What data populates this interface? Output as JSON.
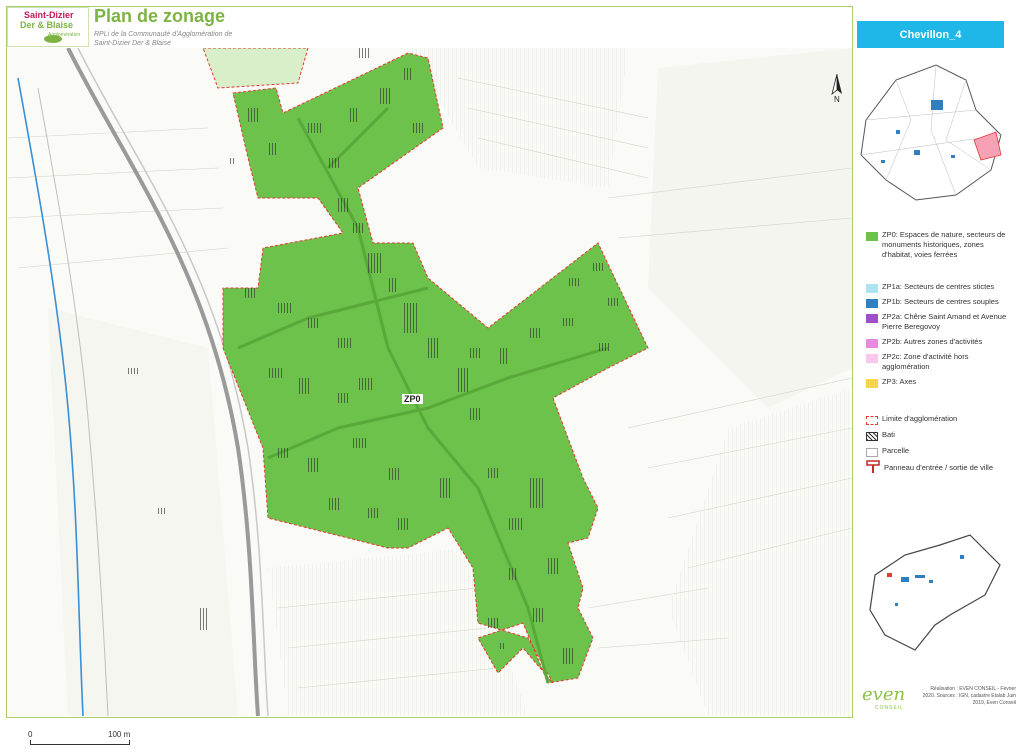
{
  "header": {
    "logo_line1": "Saint-Dizier",
    "logo_line2": "Der & Blaise",
    "logo_line3": "Agglomération",
    "title": "Plan de zonage",
    "subtitle": "RPLi de la Communauté d'Agglomération de Saint-Dizier Der & Blaise"
  },
  "map": {
    "zone_label": "ZP0",
    "north_label": "N",
    "scale_start": "0",
    "scale_end": "100 m"
  },
  "panel": {
    "commune": "Chevillon_4",
    "legend": [
      {
        "label": "ZP0: Espaces de nature, secteurs de monuments historiques, zones d'habitat, voies ferrées",
        "color": "#6cc24a"
      },
      {
        "label": "ZP1a: Secteurs de centres stictes",
        "color": "#aee3f2"
      },
      {
        "label": "ZP1b: Secteurs de centres souples",
        "color": "#2f7fc1"
      },
      {
        "label": "ZP2a: Chêne Saint Amand et Avenue Pierre Beregovoy",
        "color": "#9c4fc9"
      },
      {
        "label": "ZP2b: Autres zones d'activités",
        "color": "#e78ae0"
      },
      {
        "label": "ZP2c: Zone d'activité hors agglomération",
        "color": "#f9c7ec"
      },
      {
        "label": "ZP3: Axes",
        "color": "#f7d54a"
      }
    ],
    "legend2": [
      {
        "label": "Limite d'agglomération",
        "kind": "dashed-red"
      },
      {
        "label": "Bati",
        "kind": "hatched"
      },
      {
        "label": "Parcelle",
        "kind": "parcel"
      },
      {
        "label": "Panneau d'entrée / sortie de ville",
        "kind": "sign"
      }
    ],
    "brand": "even",
    "brand_sub": "CONSEIL",
    "credits": "Réalisation : EVEN CONSEIL - Février 2020. Sources : IGN, cadastre Etalab Juin 2019, Even Conseil"
  },
  "colors": {
    "zone_green": "#6cc24a",
    "accent_blue": "#1fb6e8",
    "brand_green": "#8bc34a",
    "boundary_red": "#e53935"
  }
}
